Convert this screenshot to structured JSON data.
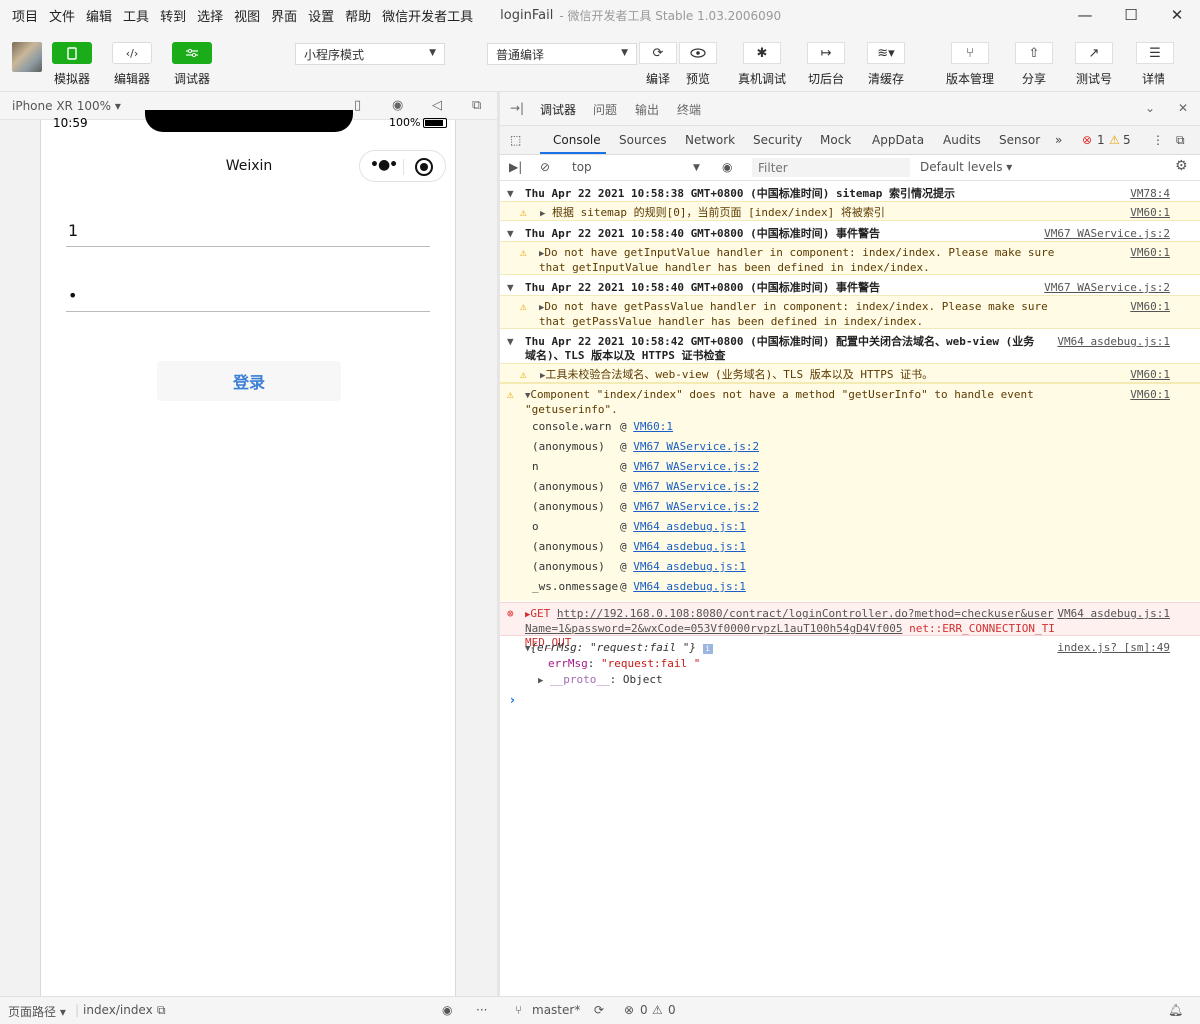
{
  "menubar": {
    "items": [
      "项目",
      "文件",
      "编辑",
      "工具",
      "转到",
      "选择",
      "视图",
      "界面",
      "设置",
      "帮助",
      "微信开发者工具"
    ],
    "window_title": "loginFail",
    "window_subtitle": "- 微信开发者工具 Stable 1.03.2006090",
    "minimize": "—",
    "maximize": "☐",
    "close": "✕"
  },
  "toolbar": {
    "simulator_label": "模拟器",
    "editor_label": "编辑器",
    "debugger_label": "调试器",
    "mode_select": "小程序模式",
    "compile_select": "普通编译",
    "compile_label": "编译",
    "preview_label": "预览",
    "real_debug_label": "真机调试",
    "backend_label": "切后台",
    "clear_cache_label": "清缓存",
    "version_label": "版本管理",
    "share_label": "分享",
    "test_label": "测试号",
    "details_label": "详情",
    "editor_glyph": "‹/›"
  },
  "simulator": {
    "device": "iPhone XR 100% ▾",
    "status_time": "10:59",
    "battery_pct": "100%",
    "nav_title": "Weixin",
    "capsule_dots": "•●•",
    "username_value": "1",
    "password_value": "•",
    "login_button": "登录"
  },
  "bottombar": {
    "page_path_label": "页面路径 ▾",
    "page_path": "index/index",
    "branch": "master*",
    "errors": "0",
    "warnings": "0",
    "ellipsis": "···"
  },
  "debugger": {
    "tabs": [
      "调试器",
      "问题",
      "输出",
      "终端"
    ],
    "devtools_tabs": [
      "Console",
      "Sources",
      "Network",
      "Security",
      "Mock",
      "AppData",
      "Audits",
      "Sensor"
    ],
    "more_tabs": "»",
    "error_count": "1",
    "warning_count": "5",
    "context": "top",
    "filter_placeholder": "Filter",
    "levels": "Default levels ▾"
  },
  "console": {
    "groups": [
      {
        "header": "Thu Apr 22 2021 10:58:38 GMT+0800 (中国标准时间) sitemap 索引情况提示",
        "header_src": "VM78:4",
        "msg": "根据 sitemap 的规则[0]，当前页面 [index/index] 将被索引",
        "msg_src": "VM60:1"
      },
      {
        "header": "Thu Apr 22 2021 10:58:40 GMT+0800 (中国标准时间) 事件警告",
        "header_src": "VM67 WAService.js:2",
        "msg": "Do not have getInputValue handler in component: index/index. Please make sure that getInputValue handler has been defined in index/index.",
        "msg_src": "VM60:1"
      },
      {
        "header": "Thu Apr 22 2021 10:58:40 GMT+0800 (中国标准时间) 事件警告",
        "header_src": "VM67 WAService.js:2",
        "msg": "Do not have getPassValue handler in component: index/index. Please make sure that getPassValue handler has been defined in index/index.",
        "msg_src": "VM60:1"
      },
      {
        "header": "Thu Apr 22 2021 10:58:42 GMT+0800 (中国标准时间) 配置中关闭合法域名、web-view (业务域名)、TLS 版本以及 HTTPS 证书检查",
        "header_src": "VM64 asdebug.js:1",
        "msg": "工具未校验合法域名、web-view (业务域名)、TLS 版本以及 HTTPS 证书。",
        "msg_src": "VM60:1"
      }
    ],
    "component_warn": "Component \"index/index\" does not have a method \"getUserInfo\" to handle event \"getuserinfo\".",
    "component_warn_src": "VM60:1",
    "stack": [
      {
        "fn": "console.warn",
        "src": "VM60:1"
      },
      {
        "fn": "(anonymous)",
        "src": "VM67 WAService.js:2"
      },
      {
        "fn": "n",
        "src": "VM67 WAService.js:2"
      },
      {
        "fn": "(anonymous)",
        "src": "VM67 WAService.js:2"
      },
      {
        "fn": "(anonymous)",
        "src": "VM67 WAService.js:2"
      },
      {
        "fn": "o",
        "src": "VM64 asdebug.js:1"
      },
      {
        "fn": "(anonymous)",
        "src": "VM64 asdebug.js:1"
      },
      {
        "fn": "(anonymous)",
        "src": "VM64 asdebug.js:1"
      },
      {
        "fn": "_ws.onmessage",
        "src": "VM64 asdebug.js:1"
      }
    ],
    "error_method": "GET",
    "error_url": "http://192.168.0.108:8080/contract/loginController.do?method=checkuser&userName=1&password=2&wxCode=053Vf0000rvpzL1auT100h54gD4Vf005",
    "error_status": "net::ERR_CONNECTION_TIMED_OUT",
    "error_src": "VM64 asdebug.js:1",
    "obj_summary": "{errMsg: \"request:fail \"}",
    "obj_src": "index.js? [sm]:49",
    "obj_key": "errMsg",
    "obj_val": "\"request:fail \"",
    "proto_key": "__proto__",
    "proto_val": "Object",
    "prompt": "›"
  }
}
